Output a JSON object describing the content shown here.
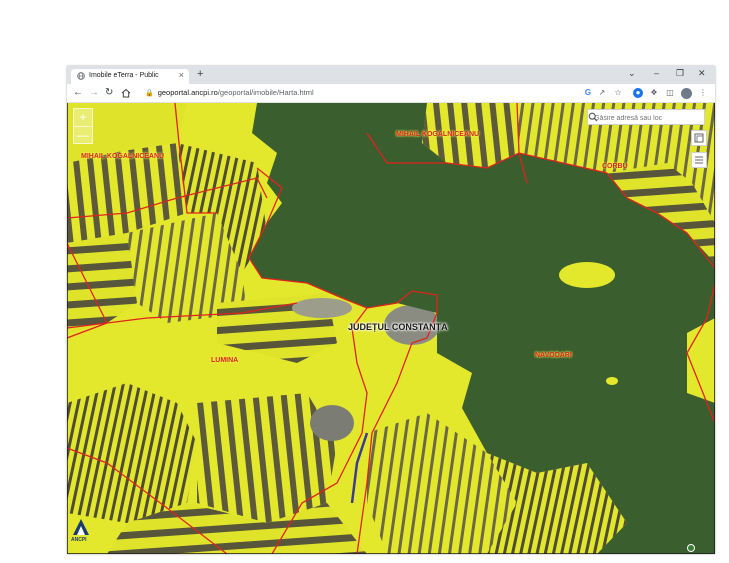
{
  "browser": {
    "tab_title": "Imobile eTerra - Public",
    "tab_close": "×",
    "new_tab": "+",
    "url_host": "geoportal.ancpi.ro",
    "url_path": "/geoportal/imobile/Harta.html"
  },
  "map": {
    "search_placeholder": "Găsire adresă sau loc",
    "zoom_in": "+",
    "zoom_out": "—",
    "county_label": "JUDEȚUL CONSTANȚA",
    "regions": [
      "MIHAIL KOGALNICEANU",
      "MIHAIL KOGALNICEANU",
      "CORBU",
      "LUMINA",
      "NAVODARI"
    ],
    "logo_text": "ANCPI",
    "colors": {
      "agri_yellow": "#e4e82c",
      "water": "#3b5e2f",
      "boundary": "#e0231c"
    }
  }
}
